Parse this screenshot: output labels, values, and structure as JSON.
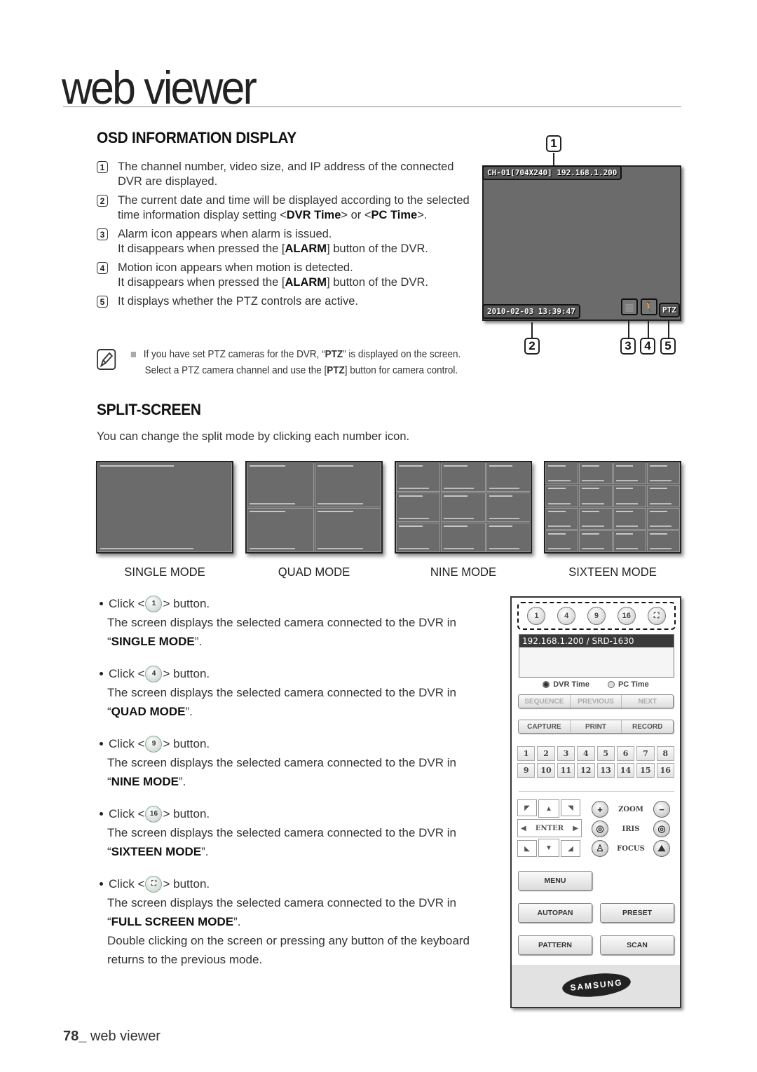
{
  "header": {
    "title": "web viewer"
  },
  "osd": {
    "title": "OSD INFORMATION DISPLAY",
    "items": [
      {
        "num": "1",
        "text": "The channel number, video size, and IP address of the connected DVR are displayed."
      },
      {
        "num": "2",
        "pre": "The current date and time will be displayed according to the selected time information display setting <",
        "b1": "DVR Time",
        "mid": "> or <",
        "b2": "PC Time",
        "post": ">."
      },
      {
        "num": "3",
        "line1": "Alarm icon appears when alarm is issued.",
        "pre": "It disappears when pressed the [",
        "b1": "ALARM",
        "post": "] button of the DVR."
      },
      {
        "num": "4",
        "line1": "Motion icon appears when motion is detected.",
        "pre": "It disappears when pressed the [",
        "b1": "ALARM",
        "post": "] button of the DVR."
      },
      {
        "num": "5",
        "text": "It displays whether the PTZ controls are active."
      }
    ],
    "note": {
      "pre": "If you have set PTZ cameras for the DVR, “",
      "b1": "PTZ",
      "mid": "” is displayed on the screen. Select a PTZ camera channel and use the [",
      "b2": "PTZ",
      "post": "] button for camera control."
    },
    "screen": {
      "channel_info": "CH-01[704X240] 192.168.1.200",
      "datetime": "2010-02-03 13:39:47",
      "ptz_label": "PTZ",
      "icons": [
        "alarm-icon",
        "motion-icon"
      ],
      "callouts": [
        "1",
        "2",
        "3",
        "4",
        "5"
      ]
    }
  },
  "split": {
    "title": "SPLIT-SCREEN",
    "intro": "You can change the split mode by clicking each number icon.",
    "modes": [
      {
        "label": "SINGLE MODE",
        "cells": 1
      },
      {
        "label": "QUAD MODE",
        "cells": 4
      },
      {
        "label": "NINE MODE",
        "cells": 9
      },
      {
        "label": "SIXTEEN MODE",
        "cells": 16
      }
    ],
    "click_items": [
      {
        "btn": "1",
        "click": "Click <",
        "after": "> button.",
        "desc": "The screen displays the selected camera connected to the DVR in",
        "mode": "SINGLE MODE",
        "extra": ""
      },
      {
        "btn": "4",
        "click": "Click <",
        "after": "> button.",
        "desc": "The screen displays the selected camera connected to the DVR in",
        "mode": "QUAD MODE",
        "extra": ""
      },
      {
        "btn": "9",
        "click": "Click <",
        "after": "> button.",
        "desc": "The screen displays the selected camera connected to the DVR in",
        "mode": "NINE MODE",
        "extra": ""
      },
      {
        "btn": "16",
        "click": "Click <",
        "after": "> button.",
        "desc": "The screen displays the selected camera connected to the DVR in",
        "mode": "SIXTEEN MODE",
        "extra": ""
      },
      {
        "btn": "⛶",
        "click": "Click <",
        "after": "> button.",
        "desc": "The screen displays the selected camera connected to the DVR in",
        "mode": "FULL SCREEN MODE",
        "extra": "Double clicking on the screen or pressing any button of the keyboard returns to the previous mode."
      }
    ]
  },
  "panel": {
    "mode_buttons": [
      "1",
      "4",
      "9",
      "16",
      "⛶"
    ],
    "dvr_entry": "192.168.1.200  / SRD-1630",
    "time_options": {
      "dvr": "DVR Time",
      "pc": "PC Time",
      "selected": "DVR Time"
    },
    "sequence_bar": [
      "SEQUENCE",
      "PREVIOUS",
      "NEXT"
    ],
    "capture_bar": [
      "CAPTURE",
      "PRINT",
      "RECORD"
    ],
    "channels": [
      "1",
      "2",
      "3",
      "4",
      "5",
      "6",
      "7",
      "8",
      "9",
      "10",
      "11",
      "12",
      "13",
      "14",
      "15",
      "16"
    ],
    "dpad": {
      "center": "ENTER"
    },
    "ptz": [
      {
        "label": "ZOOM",
        "left": "+",
        "right": "−"
      },
      {
        "label": "IRIS",
        "left": "◎",
        "right": "◎"
      },
      {
        "label": "FOCUS",
        "left": "♙",
        "right": "⛰"
      }
    ],
    "buttons": {
      "menu": "MENU",
      "autopan": "AUTOPAN",
      "preset": "PRESET",
      "pattern": "PATTERN",
      "scan": "SCAN"
    },
    "logo": "SAMSUNG"
  },
  "footer": {
    "page": "78_",
    "label": " web viewer"
  }
}
